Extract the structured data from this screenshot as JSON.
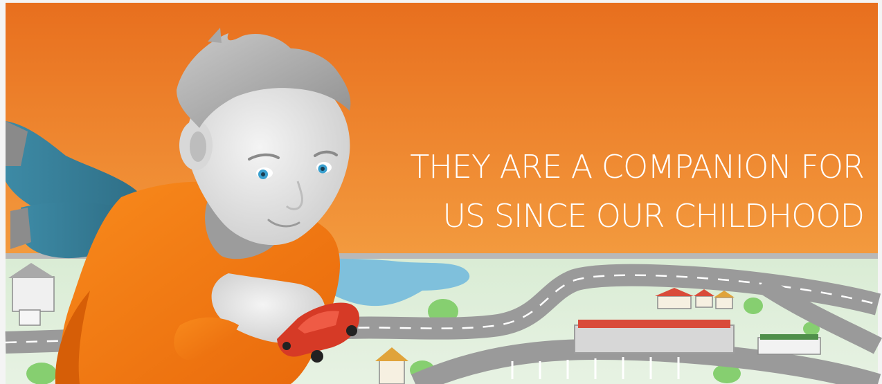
{
  "hero": {
    "headline_line1": "THEY ARE A COMPANION FOR",
    "headline_line2": "US SINCE OUR CHILDHOOD"
  },
  "colors": {
    "orange_top": "#e86f1e",
    "orange_bottom": "#f2963a",
    "map_green": "#d8ecd2",
    "road_gray": "#9a9a9a",
    "lake_blue": "#7fc0dc",
    "shirt_orange": "#f57d12",
    "toy_car_red": "#d63a26"
  },
  "illustration": {
    "subject": "boy-lying-on-floor-playing-with-toy-car",
    "icons": [
      "boy-illustration-icon",
      "toy-car-icon",
      "road-map-icon",
      "lake-icon",
      "house-icon"
    ]
  }
}
